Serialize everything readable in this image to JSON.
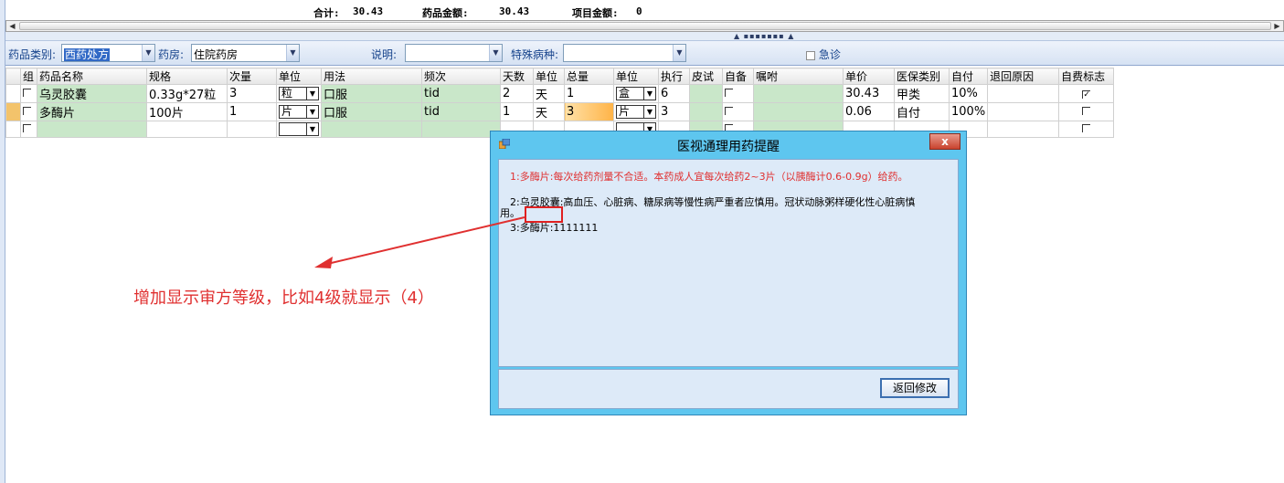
{
  "totals": {
    "total_label": "合计:",
    "total_value": "30.43",
    "drug_amount_label": "药品金额:",
    "drug_amount_value": "30.43",
    "item_amount_label": "项目金额:",
    "item_amount_value": "0"
  },
  "filters": {
    "drug_category_label": "药品类别:",
    "drug_category_value": "西药处方",
    "pharmacy_label": "药房:",
    "pharmacy_value": "住院药房",
    "note_label": "说明:",
    "note_value": "",
    "special_disease_label": "特殊病种:",
    "special_disease_value": "",
    "emergency_label": "急诊"
  },
  "grid": {
    "headers": [
      "组",
      "药品名称",
      "规格",
      "次量",
      "单位",
      "用法",
      "频次",
      "天数",
      "单位",
      "总量",
      "单位",
      "执行",
      "皮试",
      "自备",
      "嘱咐",
      "单价",
      "医保类别",
      "自付",
      "退回原因",
      "自费标志"
    ],
    "rows": [
      {
        "name": "乌灵胶囊",
        "spec": "0.33g*27粒",
        "dose": "3",
        "dose_unit": "粒",
        "usage": "口服",
        "freq": "tid",
        "days": "2",
        "day_unit": "天",
        "total": "1",
        "total_unit": "盒",
        "exec": "6",
        "price": "30.43",
        "insurance": "甲类",
        "copay": "10%",
        "self_pay_checked": true
      },
      {
        "name": "多酶片",
        "spec": "100片",
        "dose": "1",
        "dose_unit": "片",
        "usage": "口服",
        "freq": "tid",
        "days": "1",
        "day_unit": "天",
        "total": "3",
        "total_unit": "片",
        "exec": "3",
        "price": "0.06",
        "insurance": "自付",
        "copay": "100%",
        "self_pay_checked": false
      }
    ]
  },
  "dialog": {
    "title": "医视通理用药提醒",
    "close_label": "x",
    "msg1": "1:多酶片:每次给药剂量不合适。本药成人宜每次给药2~3片（以胰酶计0.6-0.9g）给药。",
    "msg2_line1": "2:乌灵胶囊:高血压、心脏病、糖尿病等慢性病严重者应慎用。冠状动脉粥样硬化性心脏病慎",
    "msg2_line2": "用。",
    "msg3": "3:多酶片:1111111",
    "return_button": "返回修改"
  },
  "annotation": "增加显示审方等级，比如4级就显示（4）",
  "colors": {
    "annotation": "#e03030",
    "dialog_frame": "#5ec6ef",
    "grid_green": "#c9e7c9"
  }
}
